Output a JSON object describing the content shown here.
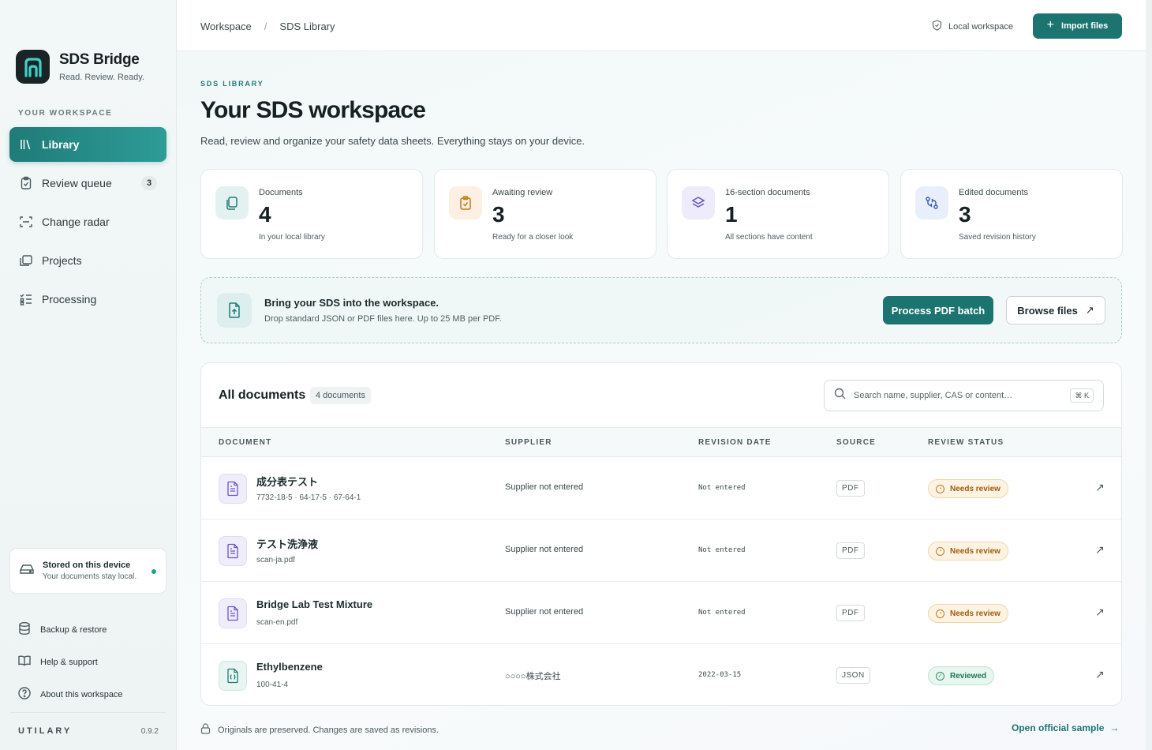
{
  "brand": {
    "name": "SDS Bridge",
    "tagline": "Read. Review. Ready."
  },
  "sidebar": {
    "section_label": "YOUR WORKSPACE",
    "items": [
      {
        "label": "Library",
        "icon": "library-icon",
        "active": true
      },
      {
        "label": "Review queue",
        "icon": "clipboard-icon",
        "count": "3"
      },
      {
        "label": "Change radar",
        "icon": "scan-icon"
      },
      {
        "label": "Projects",
        "icon": "folders-icon"
      },
      {
        "label": "Processing",
        "icon": "list-checks-icon"
      }
    ],
    "storage": {
      "title": "Stored on this device",
      "subtitle": "Your documents stay local."
    },
    "footer_links": [
      {
        "label": "Backup & restore",
        "icon": "database-icon"
      },
      {
        "label": "Help & support",
        "icon": "book-icon"
      },
      {
        "label": "About this workspace",
        "icon": "help-circle-icon"
      }
    ],
    "company": "UTILARY",
    "version": "0.9.2"
  },
  "topbar": {
    "breadcrumb": [
      "Workspace",
      "SDS Library"
    ],
    "breadcrumb_sep": "/",
    "local_workspace": "Local workspace",
    "import_label": "Import files"
  },
  "page": {
    "eyebrow": "SDS LIBRARY",
    "title": "Your SDS workspace",
    "subtitle": "Read, review and organize your safety data sheets. Everything stays on your device."
  },
  "stats": [
    {
      "label": "Documents",
      "value": "4",
      "sub": "In your local library",
      "icon": "copy-icon",
      "color": "#e3f2f1"
    },
    {
      "label": "Awaiting review",
      "value": "3",
      "sub": "Ready for a closer look",
      "icon": "clipboard-check-icon",
      "color": "#fdf0e2"
    },
    {
      "label": "16-section documents",
      "value": "1",
      "sub": "All sections have content",
      "icon": "layers-icon",
      "color": "#eeebfb"
    },
    {
      "label": "Edited documents",
      "value": "3",
      "sub": "Saved revision history",
      "icon": "git-compare-icon",
      "color": "#e9eefb"
    }
  ],
  "dropzone": {
    "title": "Bring your SDS into the workspace.",
    "subtitle": "Drop standard JSON or PDF files here. Up to 25 MB per PDF.",
    "primary": "Process PDF batch",
    "secondary": "Browse files"
  },
  "documents": {
    "title": "All documents",
    "count_label": "4 documents",
    "search_placeholder": "Search name, supplier, CAS or content…",
    "search_shortcut": "⌘ K",
    "columns": [
      "DOCUMENT",
      "SUPPLIER",
      "REVISION DATE",
      "SOURCE",
      "REVIEW STATUS"
    ],
    "rows": [
      {
        "name": "成分表テスト",
        "meta": "7732-18-5 · 64-17-5 · 67-64-1",
        "supplier": "Supplier not entered",
        "date": "Not entered",
        "source": "PDF",
        "status": "Needs review",
        "status_kind": "warn"
      },
      {
        "name": "テスト洗浄液",
        "meta": "scan-ja.pdf",
        "supplier": "Supplier not entered",
        "date": "Not entered",
        "source": "PDF",
        "status": "Needs review",
        "status_kind": "warn"
      },
      {
        "name": "Bridge Lab Test Mixture",
        "meta": "scan-en.pdf",
        "supplier": "Supplier not entered",
        "date": "Not entered",
        "source": "PDF",
        "status": "Needs review",
        "status_kind": "warn"
      },
      {
        "name": "Ethylbenzene",
        "meta": "100-41-4",
        "supplier": "○○○○株式会社",
        "date": "2022-03-15",
        "source": "JSON",
        "status": "Reviewed",
        "status_kind": "ok"
      }
    ]
  },
  "footer": {
    "note": "Originals are preserved. Changes are saved as revisions.",
    "link": "Open official sample"
  },
  "colors": {
    "accent": "#1c7471",
    "warn": "#c17a16",
    "ok": "#2a9265"
  }
}
